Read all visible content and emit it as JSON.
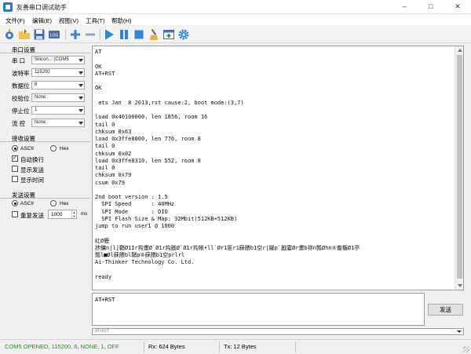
{
  "window": {
    "title": "友善串口调试助手",
    "minimize": "–",
    "maximize": "□",
    "close": "✕"
  },
  "menu": [
    "文件(F)",
    "编辑(E)",
    "视图(V)",
    "工具(T)",
    "帮助(H)"
  ],
  "serial_settings": {
    "title": "串口设置",
    "port_label": "串 口",
    "port_value": "Silicon... (COM5",
    "baud_label": "波特率",
    "baud_value": "115200",
    "databits_label": "数据位",
    "databits_value": "8",
    "parity_label": "校验位",
    "parity_value": "None",
    "stopbits_label": "停止位",
    "stopbits_value": "1",
    "flow_label": "流 控",
    "flow_value": "None"
  },
  "receive_settings": {
    "title": "接收设置",
    "ascii_label": "ASCII",
    "hex_label": "Hex",
    "auto_wrap_label": "自动换行",
    "show_send_label": "显示发送",
    "show_time_label": "显示时间"
  },
  "send_settings": {
    "title": "发送设置",
    "ascii_label": "ASCII",
    "hex_label": "Hex",
    "repeat_label": "重复发送",
    "interval_value": "1000",
    "interval_unit": "ms"
  },
  "output_lines": [
    "AT",
    "",
    "OK",
    "AT+RST",
    "",
    "OK",
    "",
    " ets Jan  8 2013,rst cause:2, boot mode:(3,7)",
    "",
    "load 0x40100000, len 1856, room 16",
    "tail 0",
    "chksum 0x63",
    "load 0x3ffe8000, len 776, room 8",
    "tail 0",
    "chksum 0x02",
    "load 0x3ffe8310, len 552, room 8",
    "tail 0",
    "chksum 0x79",
    "csum 0x79",
    "",
    "2nd boot version : 1.5",
    "  SPI Speed      : 40MHz",
    "  SPI Mode       : DIO",
    "  SPI Flash Size & Map: 32Mbit(512KB+512KB)",
    "jump to run user1 @ 1000",
    "",
    "屸Ø鹿",
    "捗鳙n|l]鞘Ø1Ir抅畫Ø`Ø1r抅戤Ø`Ø1r抅帳•ll`Ør1匪r1蔝餵b1空r|嬥p`戤霎Ør畫b祢n瓢Øhn④畜棴Ø1亭",
    "瓢l■Øl蔝餵bl鞘p④蔝餵b1空prlrl",
    "Ai-Thinker Technology Co. Ltd.",
    "",
    "ready"
  ],
  "input_text": "AT+RST",
  "send_button": "发送",
  "history_value": "AT+RST",
  "status": {
    "port": "COM5 OPENED, 115200, 8, NONE, 1, OFF",
    "rx": "Rx: 624 Bytes",
    "tx": "Tx: 12 Bytes"
  },
  "colors": {
    "status_port": "#1a9a1a",
    "accent_blue": "#2a78d0"
  }
}
